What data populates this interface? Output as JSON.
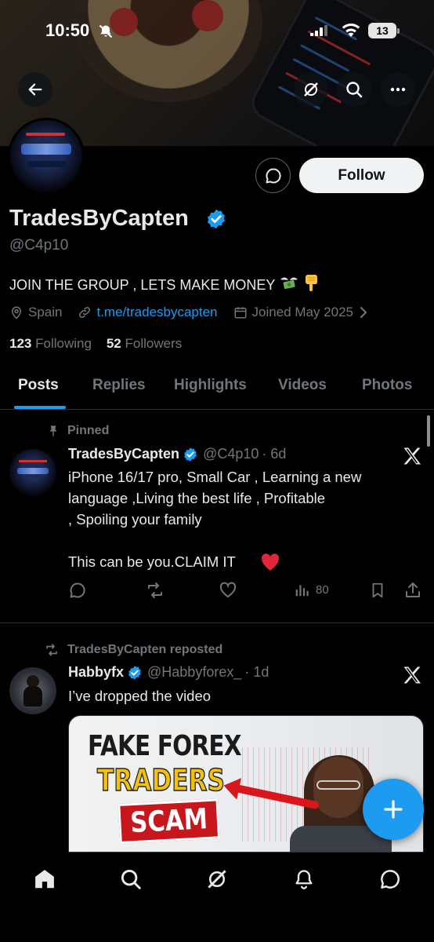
{
  "status_bar": {
    "time": "10:50",
    "battery": "13"
  },
  "profile": {
    "name": "TradesByCapten",
    "handle": "@C4p10",
    "bio": "JOIN THE GROUP , LETS MAKE MONEY",
    "location": "Spain",
    "link": "t.me/tradesbycapten",
    "joined": "Joined May 2025",
    "following_count": "123",
    "following_label": "Following",
    "followers_count": "52",
    "followers_label": "Followers",
    "follow_button": "Follow"
  },
  "tabs": [
    {
      "label": "Posts",
      "active": true
    },
    {
      "label": "Replies"
    },
    {
      "label": "Highlights"
    },
    {
      "label": "Videos"
    },
    {
      "label": "Photos"
    }
  ],
  "posts": [
    {
      "context": "Pinned",
      "author": "TradesByCapten",
      "handle": "@C4p10",
      "time": "· 6d",
      "text": "iPhone 16/17 pro, Small Car , Learning a new\nlanguage ,Living the best life , Profitable\n, Spoiling your family\n\nThis can be you.CLAIM IT",
      "views": "80"
    },
    {
      "context": "TradesByCapten reposted",
      "author": "Habbyfx",
      "handle": "@Habbyforex_",
      "time": "· 1d",
      "text": "I’ve dropped the video",
      "thumbnail": {
        "line1": "FAKE FOREX",
        "line2": "TRADERS",
        "line3": "SCAM"
      }
    }
  ],
  "colors": {
    "accent": "#1d9bf0",
    "background": "#000000",
    "muted": "#71767b",
    "text": "#e7e9ea"
  }
}
